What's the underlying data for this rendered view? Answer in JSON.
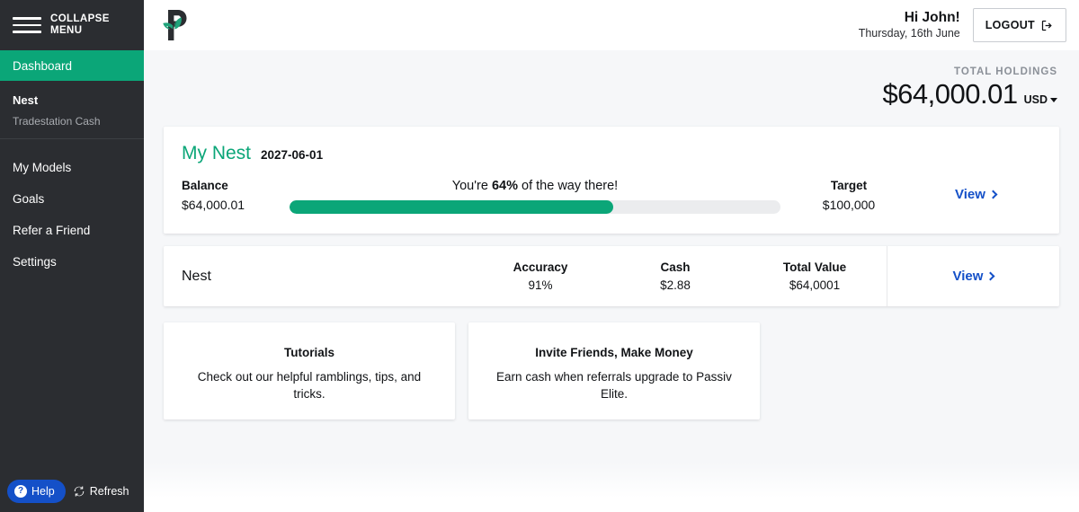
{
  "sidebar": {
    "collapse_label": "COLLAPSE MENU",
    "collapse_line1": "COLLAPSE",
    "collapse_line2": "MENU",
    "dashboard_label": "Dashboard",
    "account": {
      "name": "Nest",
      "subtitle": "Tradestation Cash"
    },
    "links": [
      {
        "label": "My Models"
      },
      {
        "label": "Goals"
      },
      {
        "label": "Refer a Friend"
      },
      {
        "label": "Settings"
      }
    ],
    "help_label": "Help",
    "help_icon_glyph": "?",
    "refresh_label": "Refresh",
    "active_color": "#0ba678",
    "background_color": "#2b2d31",
    "help_color": "#1450c8"
  },
  "header": {
    "logo_name": "passiv-logo",
    "greeting": "Hi John!",
    "date": "Thursday, 16th June",
    "logout_label": "LOGOUT"
  },
  "holdings": {
    "label": "TOTAL HOLDINGS",
    "amount": "$64,000.01",
    "currency": "USD"
  },
  "goal_card": {
    "title": "My Nest",
    "date": "2027-06-01",
    "balance_label": "Balance",
    "balance_value": "$64,000.01",
    "progress_prefix": "You're ",
    "progress_percent": "64%",
    "progress_suffix": " of the way there!",
    "progress_fill": 66,
    "target_label": "Target",
    "target_value": "$100,000",
    "view_label": "View",
    "accent_color": "#0ba678",
    "link_color": "#1450c8"
  },
  "account_card": {
    "name": "Nest",
    "metrics": [
      {
        "label": "Accuracy",
        "value": "91%"
      },
      {
        "label": "Cash",
        "value": "$2.88"
      },
      {
        "label": "Total Value",
        "value": "$64,0001"
      }
    ],
    "view_label": "View"
  },
  "promos": [
    {
      "title": "Tutorials",
      "description": "Check out our helpful ramblings, tips, and tricks."
    },
    {
      "title": "Invite Friends, Make Money",
      "description": "Earn cash when referrals upgrade to Passiv Elite."
    }
  ]
}
